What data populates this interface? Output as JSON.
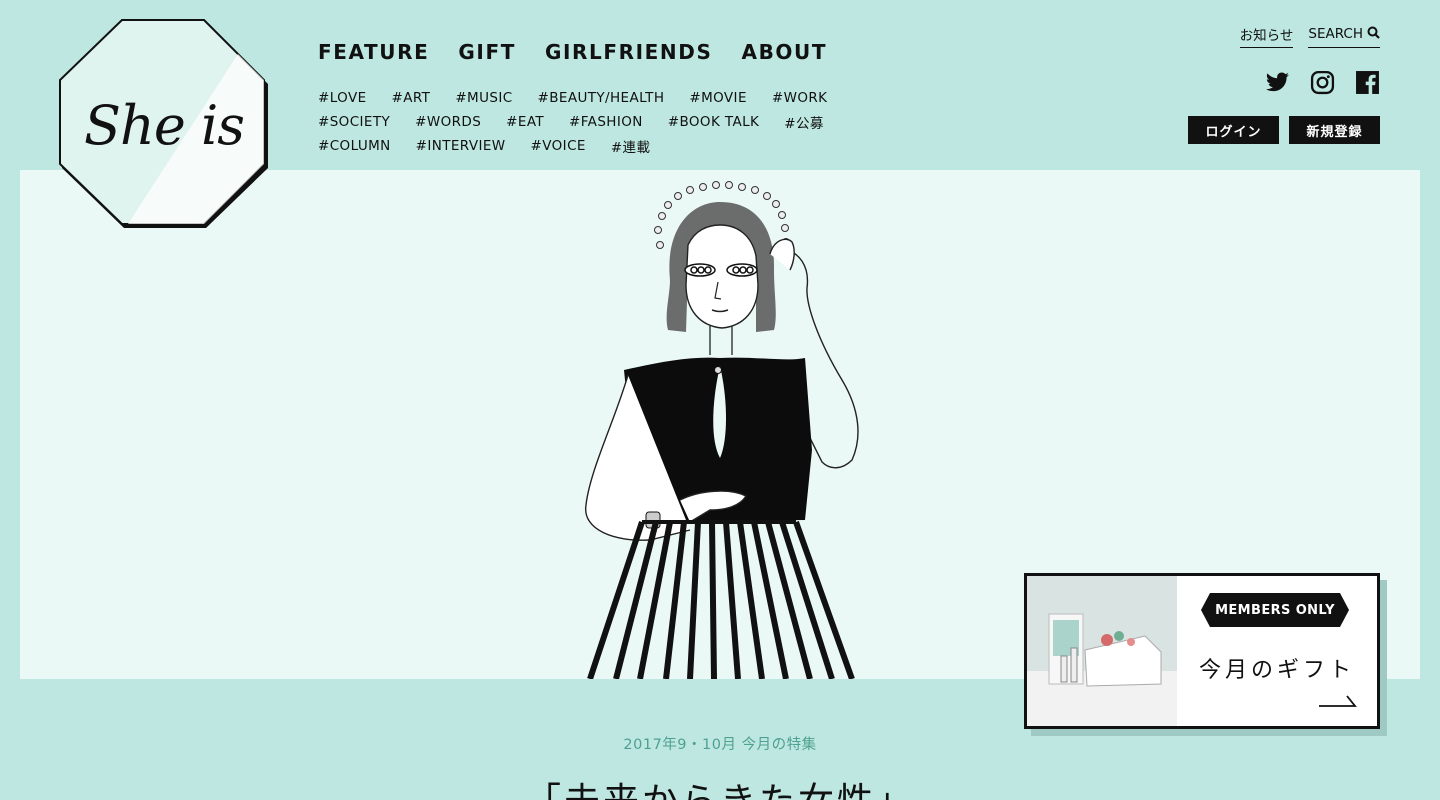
{
  "logo": {
    "text": "She is"
  },
  "nav": {
    "main": [
      "FEATURE",
      "GIFT",
      "GIRLFRIENDS",
      "ABOUT"
    ],
    "tag_rows": [
      [
        "#LOVE",
        "#ART",
        "#MUSIC",
        "#BEAUTY/HEALTH",
        "#MOVIE",
        "#WORK"
      ],
      [
        "#SOCIETY",
        "#WORDS",
        "#EAT",
        "#FASHION",
        "#BOOK TALK",
        "#公募"
      ],
      [
        "#COLUMN",
        "#INTERVIEW",
        "#VOICE",
        "#連載"
      ]
    ]
  },
  "utility": {
    "news": "お知らせ",
    "search": "SEARCH"
  },
  "social": {
    "icons": [
      "twitter-icon",
      "instagram-icon",
      "facebook-icon"
    ]
  },
  "auth": {
    "login": "ログイン",
    "signup": "新規登録"
  },
  "gift": {
    "badge": "MEMBERS ONLY",
    "title": "今月のギフト"
  },
  "feature": {
    "date": "2017年9・10月 今月の特集",
    "title": "「未来からきた女性」"
  },
  "colors": {
    "page_bg": "#bde7e0",
    "hero_bg": "#ebf9f6",
    "accent_text": "#4fa18f",
    "ink": "#111111"
  }
}
